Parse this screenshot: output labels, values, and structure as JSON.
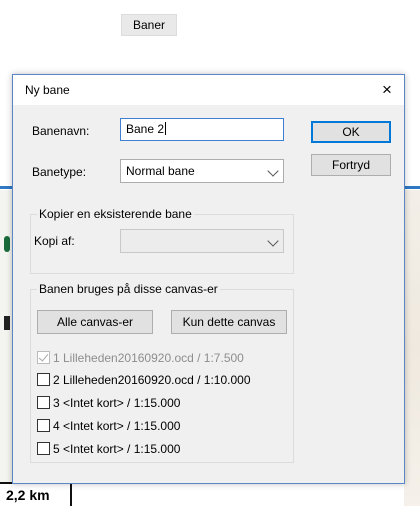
{
  "background": {
    "toolbar_button": "Baner",
    "scale_text": "2,2 km",
    "colors": {
      "map_line": "#2f78c4",
      "map_green": "#1a6b3a"
    }
  },
  "dialog": {
    "title": "Ny bane",
    "close_icon": "×",
    "name_label": "Banenavn:",
    "name_value": "Bane 2",
    "type_label": "Banetype:",
    "type_value": "Normal bane",
    "ok_button": "OK",
    "cancel_button": "Fortryd",
    "copy_group": {
      "title": "Kopier en eksisterende bane",
      "label": "Kopi af:",
      "value": ""
    },
    "canvas_group": {
      "title": "Banen bruges på disse canvas-er",
      "all_button": "Alle canvas-er",
      "only_button": "Kun dette canvas",
      "items": [
        {
          "label": "1 Lilleheden20160920.ocd  / 1:7.500",
          "checked": true,
          "disabled": true
        },
        {
          "label": "2 Lilleheden20160920.ocd  / 1:10.000",
          "checked": false,
          "disabled": false
        },
        {
          "label": "3 <Intet kort>  / 1:15.000",
          "checked": false,
          "disabled": false
        },
        {
          "label": "4 <Intet kort>  / 1:15.000",
          "checked": false,
          "disabled": false
        },
        {
          "label": "5 <Intet kort>  / 1:15.000",
          "checked": false,
          "disabled": false
        }
      ]
    },
    "accent": "#0078d7"
  }
}
